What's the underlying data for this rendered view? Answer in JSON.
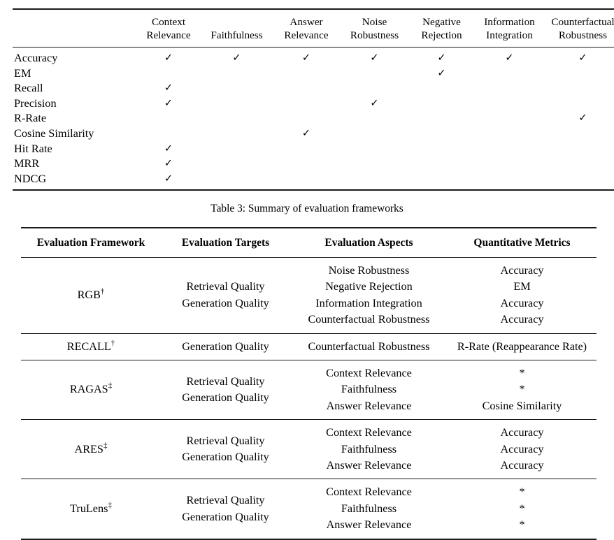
{
  "table_metrics": {
    "columns": [
      "Context Relevance",
      "Faithfulness",
      "Answer Relevance",
      "Noise Robustness",
      "Negative Rejection",
      "Information Integration",
      "Counterfactual Robustness"
    ],
    "column_lines": [
      [
        "Context",
        "Relevance"
      ],
      [
        "Faithfulness",
        ""
      ],
      [
        "Answer",
        "Relevance"
      ],
      [
        "Noise",
        "Robustness"
      ],
      [
        "Negative",
        "Rejection"
      ],
      [
        "Information",
        "Integration"
      ],
      [
        "Counterfactual",
        "Robustness"
      ]
    ],
    "check_glyph": "✓",
    "rows": [
      {
        "label": "Accuracy",
        "marks": [
          true,
          true,
          true,
          true,
          true,
          true,
          true
        ]
      },
      {
        "label": "EM",
        "marks": [
          false,
          false,
          false,
          false,
          true,
          false,
          false
        ]
      },
      {
        "label": "Recall",
        "marks": [
          true,
          false,
          false,
          false,
          false,
          false,
          false
        ]
      },
      {
        "label": "Precision",
        "marks": [
          true,
          false,
          false,
          true,
          false,
          false,
          false
        ]
      },
      {
        "label": "R-Rate",
        "marks": [
          false,
          false,
          false,
          false,
          false,
          false,
          true
        ]
      },
      {
        "label": "Cosine Similarity",
        "marks": [
          false,
          false,
          true,
          false,
          false,
          false,
          false
        ]
      },
      {
        "label": "Hit Rate",
        "marks": [
          true,
          false,
          false,
          false,
          false,
          false,
          false
        ]
      },
      {
        "label": "MRR",
        "marks": [
          true,
          false,
          false,
          false,
          false,
          false,
          false
        ]
      },
      {
        "label": "NDCG",
        "marks": [
          true,
          false,
          false,
          false,
          false,
          false,
          false
        ]
      }
    ]
  },
  "caption": "Table 3: Summary of evaluation frameworks",
  "table_frameworks": {
    "headers": [
      "Evaluation Framework",
      "Evaluation Targets",
      "Evaluation Aspects",
      "Quantitative Metrics"
    ],
    "rows": [
      {
        "framework": "RGB",
        "mark": "†",
        "targets": [
          "Retrieval Quality",
          "Generation Quality"
        ],
        "aspects": [
          "Noise Robustness",
          "Negative Rejection",
          "Information Integration",
          "Counterfactual Robustness"
        ],
        "metrics": [
          "Accuracy",
          "EM",
          "Accuracy",
          "Accuracy"
        ]
      },
      {
        "framework": "RECALL",
        "mark": "†",
        "targets": [
          "Generation Quality"
        ],
        "aspects": [
          "Counterfactual Robustness"
        ],
        "metrics": [
          "R-Rate (Reappearance Rate)"
        ]
      },
      {
        "framework": "RAGAS",
        "mark": "‡",
        "targets": [
          "Retrieval Quality",
          "Generation Quality"
        ],
        "aspects": [
          "Context Relevance",
          "Faithfulness",
          "Answer Relevance"
        ],
        "metrics": [
          "*",
          "*",
          "Cosine Similarity"
        ]
      },
      {
        "framework": "ARES",
        "mark": "‡",
        "targets": [
          "Retrieval Quality",
          "Generation Quality"
        ],
        "aspects": [
          "Context Relevance",
          "Faithfulness",
          "Answer Relevance"
        ],
        "metrics": [
          "Accuracy",
          "Accuracy",
          "Accuracy"
        ]
      },
      {
        "framework": "TruLens",
        "mark": "‡",
        "targets": [
          "Retrieval Quality",
          "Generation Quality"
        ],
        "aspects": [
          "Context Relevance",
          "Faithfulness",
          "Answer Relevance"
        ],
        "metrics": [
          "*",
          "*",
          "*"
        ]
      }
    ]
  }
}
